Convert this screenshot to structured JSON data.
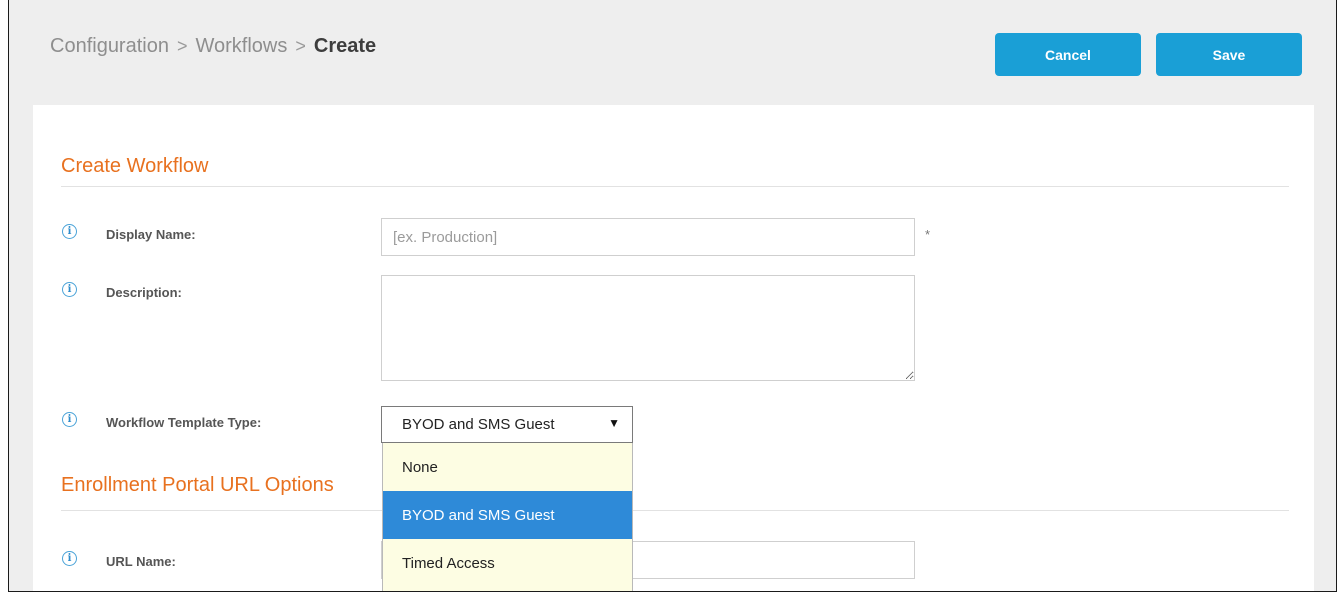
{
  "breadcrumb": {
    "items": [
      "Configuration",
      "Workflows"
    ],
    "separator": ">",
    "current": "Create"
  },
  "toolbar": {
    "cancel_label": "Cancel",
    "save_label": "Save"
  },
  "form": {
    "section_title": "Create Workflow",
    "display_name": {
      "label": "Display Name:",
      "placeholder": "[ex. Production]",
      "required_mark": "*"
    },
    "description": {
      "label": "Description:"
    },
    "template_type": {
      "label": "Workflow Template Type:",
      "selected": "BYOD and SMS Guest",
      "options": [
        "None",
        "BYOD and SMS Guest",
        "Timed Access"
      ]
    }
  },
  "enrollment": {
    "section_title": "Enrollment Portal URL Options",
    "url_name": {
      "label": "URL Name:"
    }
  },
  "icons": {
    "info": "info-icon",
    "dropdown_arrow": "caret-down-icon"
  },
  "colors": {
    "accent": "#1a9fd6",
    "section_title": "#e8711f",
    "selected_option": "#2e8ad8",
    "dropdown_bg": "#fdfde3"
  }
}
